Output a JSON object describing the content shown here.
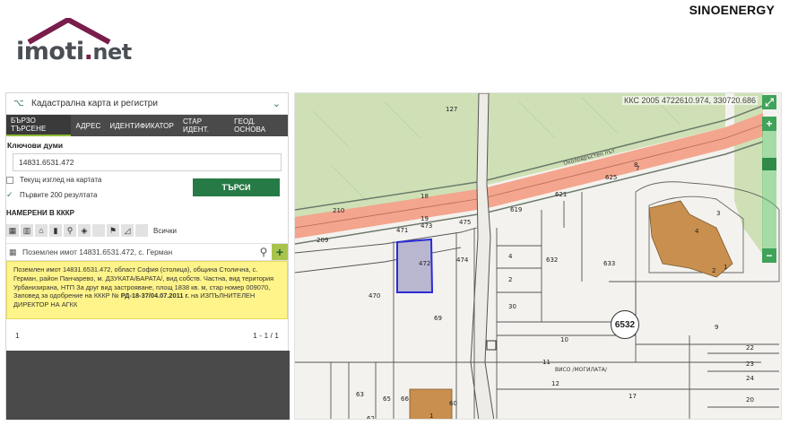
{
  "header": {
    "logo_main": "imoti",
    "logo_dot": ".",
    "logo_tld": "net",
    "brand": "SINOENERGY",
    "roof_color": "#7a1c4c"
  },
  "panel": {
    "title": "Кадастрална карта и регистри",
    "tabs": [
      "БЪРЗО ТЪРСЕНЕ",
      "АДРЕС",
      "ИДЕНТИФИКАТОР",
      "СТАР ИДЕНТ.",
      "ГЕОД. ОСНОВА"
    ],
    "active_tab": 0,
    "keywords_label": "Ключови думи",
    "keywords_value": "14831.6531.472",
    "current_view_label": "Текущ изглед на картата",
    "current_view_checked": false,
    "first200_label": "Първите 200 резултата",
    "first200_checked": true,
    "search_button": "ТЪРСИ",
    "found_title": "НАМЕРЕНИ В КККР",
    "filter_all": "Всички",
    "result_title": "Поземлен имот 14831.6531.472, с. Герман",
    "result_text": "Поземлен имот 14831.6531.472, област София (столица), община Столична, с. Герман, район Панчарево, м. ДЗУКАТА/БАРАТА/, вид собств. Частна, вид територия Урбанизирана, НТП За друг вид застрояване, площ 1838 кв. м, стар номер 009070,",
    "result_order_prefix": "Заповед за одобрение на КККР № ",
    "result_order_bold": "РД-18-37/04.07.2011 г.",
    "result_order_suffix": " на ИЗПЪЛНИТЕЛЕН ДИРЕКТОР НА АГКК",
    "page_current": "1",
    "page_info": "1 - 1 / 1"
  },
  "map": {
    "coords": "ККС 2005 4722610.974, 330720.686",
    "sheet": "6532",
    "street_top": "Околовръстен път",
    "locality": "ВИСО /МОГИЛАТА/",
    "parcel_labels": [
      "127",
      "210",
      "209",
      "471",
      "473",
      "475",
      "472",
      "474",
      "4",
      "2",
      "30",
      "632",
      "633",
      "619",
      "621",
      "625",
      "470",
      "69",
      "10",
      "9",
      "11",
      "12",
      "17",
      "22",
      "23",
      "24",
      "20",
      "63",
      "65",
      "66",
      "62",
      "60",
      "18",
      "19",
      "1",
      "2",
      "1",
      "8",
      "7",
      "3",
      "4"
    ],
    "highlight_color": "#b9b6d0",
    "road_color": "#f3a58e",
    "forest_color": "#cfe0b6",
    "building_color": "#c98f4e"
  }
}
